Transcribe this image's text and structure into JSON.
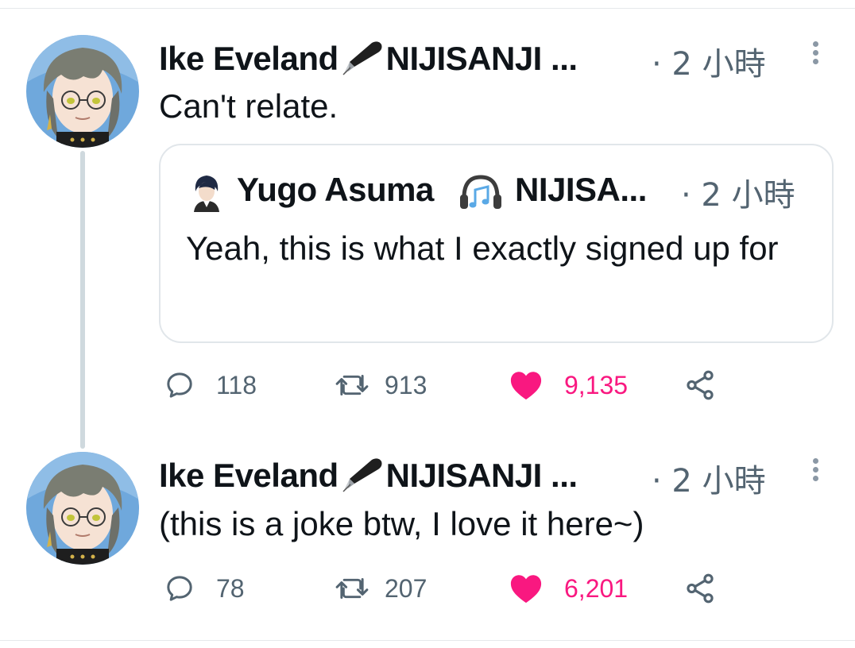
{
  "tweets": [
    {
      "author": "Ike Eveland",
      "affiliation": "NIJISANJI ...",
      "time": "· 2 小時",
      "text": "Can't relate.",
      "quote": {
        "author": "Yugo Asuma",
        "affiliation": "NIJISA...",
        "time": "· 2 小時",
        "text": "Yeah, this is what I exactly signed up for"
      },
      "stats": {
        "replies": "118",
        "retweets": "913",
        "likes": "9,135"
      }
    },
    {
      "author": "Ike Eveland",
      "affiliation": "NIJISANJI ...",
      "time": "· 2 小時",
      "text": "(this is a joke btw, I love it here~)",
      "stats": {
        "replies": "78",
        "retweets": "207",
        "likes": "6,201"
      }
    }
  ],
  "icons": {
    "reply": "speech-bubble-icon",
    "retweet": "retweet-arrows-icon",
    "like": "heart-icon",
    "share": "share-icon",
    "more": "vertical-dots-icon",
    "pen": "fountain-pen-icon",
    "headphones": "headphones-music-icon"
  },
  "colors": {
    "text": "#0f1419",
    "muted": "#536471",
    "like": "#f91880",
    "border": "#e1e6ea",
    "thread_line": "#cfd9de"
  }
}
